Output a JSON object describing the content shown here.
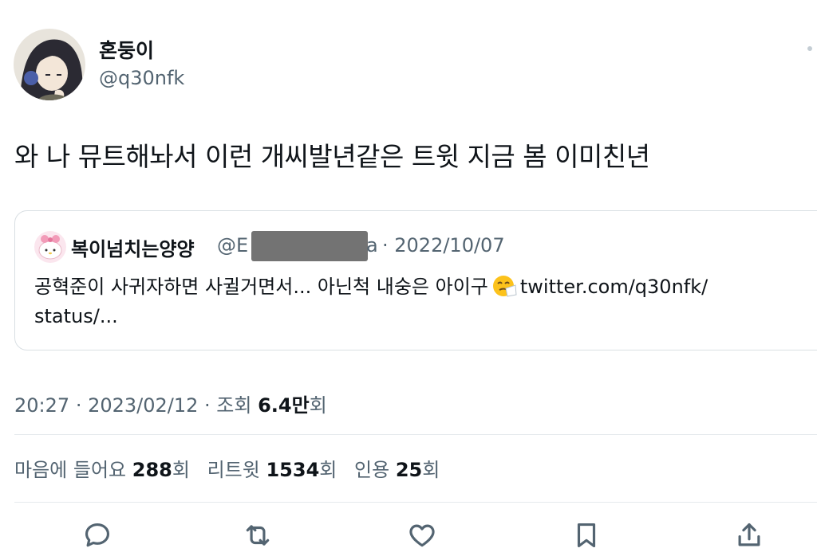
{
  "author": {
    "display_name": "혼둥이",
    "handle": "@q30nfk"
  },
  "tweet": {
    "text": "와 나 뮤트해놔서 이런 개씨발년같은 트윗 지금 봄 이미친년"
  },
  "quoted_tweet": {
    "display_name": "복이넘치는양양",
    "handle_start": "@E",
    "handle_end": "a",
    "date": "· 2022/10/07",
    "text_line1": "공혁준이 사귀자하면 사귈거면서... 아닌척 내숭은 아이구",
    "link_line1": "twitter.com/q30nfk/",
    "link_line2": "status/...",
    "emoji": "sneezing-face"
  },
  "meta": {
    "time": "20:27",
    "date": "· 2023/02/12 ·",
    "views_label": "조회",
    "views_value": "6.4만",
    "views_suffix": "회"
  },
  "stats": {
    "likes_label": "마음에 들어요",
    "likes_value": "288",
    "likes_suffix": "회",
    "retweets_label": "리트윗",
    "retweets_value": "1534",
    "retweets_suffix": "회",
    "quotes_label": "인용",
    "quotes_value": "25",
    "quotes_suffix": "회"
  },
  "actions": {
    "reply": "reply-icon",
    "retweet": "retweet-icon",
    "like": "heart-icon",
    "bookmark": "bookmark-icon",
    "share": "share-icon"
  },
  "colors": {
    "text_primary": "#0f1419",
    "text_secondary": "#536471",
    "border": "#d9dfe3",
    "redaction": "#737373"
  }
}
